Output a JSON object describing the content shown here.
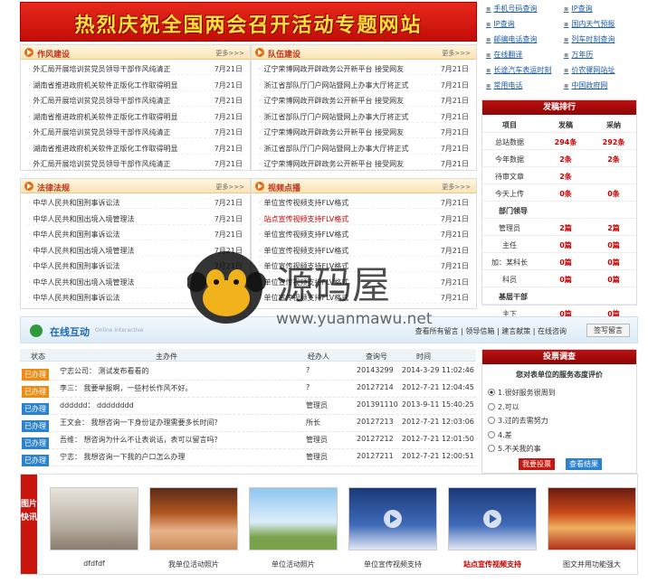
{
  "banner": {
    "title": "热烈庆祝全国两会召开活动专题网站"
  },
  "quick_links": [
    "手机号码查询",
    "IP查询",
    "邮编电话查询",
    "在线翻译",
    "长途汽车表运时刻",
    "常用电话",
    "IP查询",
    "国内天气预报",
    "列车时刻查询",
    "万年历",
    "价农骤网站址",
    "中国政府网"
  ],
  "panels": [
    {
      "title": "作风建设",
      "more": "更多>>>",
      "rows": [
        {
          "t": "外汇局开展培训贫党员领导干部作风纯清正",
          "d": "7月21日"
        },
        {
          "t": "湖南省推进政府机关软件正版化工作取得明显",
          "d": "7月21日"
        },
        {
          "t": "外汇局开展培训贫党员领导干部作风纯清正",
          "d": "7月21日"
        },
        {
          "t": "湖南省推进政府机关软件正版化工作取得明显",
          "d": "7月21日"
        },
        {
          "t": "外汇局开展培训贫党员领导干部作风纯清正",
          "d": "7月21日"
        },
        {
          "t": "湖南省推进政府机关软件正版化工作取得明显",
          "d": "7月21日"
        },
        {
          "t": "外汇局开展培训贫党员领导干部作风纯清正",
          "d": "7月21日"
        }
      ]
    },
    {
      "title": "队伍建设",
      "more": "更多>>>",
      "rows": [
        {
          "t": "辽宁荣博网政开辟政务公开新平台 接受网友",
          "d": "7月21日"
        },
        {
          "t": "浙江省部队厅门户网站暨网上办事大厅将正式",
          "d": "7月21日"
        },
        {
          "t": "辽宁荣博网政开辟政务公开新平台 接受网友",
          "d": "7月21日"
        },
        {
          "t": "浙江省部队厅门户网站暨网上办事大厅将正式",
          "d": "7月21日"
        },
        {
          "t": "辽宁荣博网政开辟政务公开新平台 接受网友",
          "d": "7月21日"
        },
        {
          "t": "浙江省部队厅门户网站暨网上办事大厅将正式",
          "d": "7月21日"
        },
        {
          "t": "辽宁荣博网政开辟政务公开新平台 接受网友",
          "d": "7月21日"
        }
      ]
    },
    {
      "title": "法律法规",
      "more": "更多>>>",
      "rows": [
        {
          "t": "中华人民共和国刑事诉讼法",
          "d": "7月21日"
        },
        {
          "t": "中华人民共和国出境入境管理法",
          "d": "7月21日"
        },
        {
          "t": "中华人民共和国刑事诉讼法",
          "d": "7月21日"
        },
        {
          "t": "中华人民共和国出境入境管理法",
          "d": "7月21日"
        },
        {
          "t": "中华人民共和国刑事诉讼法",
          "d": "7月21日"
        },
        {
          "t": "中华人民共和国出境入境管理法",
          "d": "7月21日"
        },
        {
          "t": "中华人民共和国刑事诉讼法",
          "d": "7月21日"
        }
      ]
    },
    {
      "title": "视频点播",
      "more": "更多>>>",
      "rows": [
        {
          "t": "单位宣传视频支持FLV格式",
          "d": "7月21日"
        },
        {
          "t": "站点宣传视频支持FLV格式",
          "d": "7月21日"
        },
        {
          "t": "单位宣传视频支持FLV格式",
          "d": "7月21日"
        },
        {
          "t": "单位宣传视频支持FLV格式",
          "d": "7月21日"
        },
        {
          "t": "单位宣传视频支持FLV格式",
          "d": "7月21日"
        },
        {
          "t": "单位宣传视频支持FLV格式",
          "d": "7月21日"
        },
        {
          "t": "单位宣传视频支持FLV格式",
          "d": "7月21日"
        }
      ]
    }
  ],
  "rank": {
    "title": "发稿排行",
    "head": [
      "项目",
      "发稿",
      "采纳"
    ],
    "rows": [
      [
        "总站数据",
        "294条",
        "292条"
      ],
      [
        "今年数据",
        "2条",
        "2条"
      ],
      [
        "待审文章",
        "2条",
        ""
      ],
      [
        "今天上传",
        "0条",
        "0条"
      ]
    ],
    "sec1": "部门领导",
    "rows2": [
      [
        "管理员",
        "2篇",
        "2篇"
      ],
      [
        "主任",
        "0篇",
        "0篇"
      ],
      [
        "加：某科长",
        "0篇",
        "0篇"
      ],
      [
        "科员",
        "0篇",
        "0篇"
      ]
    ],
    "sec2": "基层干部",
    "rows3": [
      [
        "主下",
        "0篇",
        "0篇"
      ]
    ]
  },
  "interact": {
    "title": "在线互动",
    "sub": "Online Interactive",
    "nav": "查看所有留言 | 领导信箱 | 建言献策 | 在线咨询",
    "button": "签写留言"
  },
  "table": {
    "head": [
      "状态",
      "主办件",
      "经办人",
      "查询号",
      "时间"
    ],
    "rows": [
      {
        "s": "已办理",
        "c": "o",
        "t": "宁志公司：  测试发布看看的",
        "p": "?",
        "n": "20143299",
        "d": "2014-3-29 11:02:46"
      },
      {
        "s": "已办理",
        "c": "o",
        "t": "李三：  我要举报啊，一些村长作风不好。",
        "p": "?",
        "n": "20127214",
        "d": "2012-7-21 12:04:45"
      },
      {
        "s": "已办理",
        "c": "b",
        "t": "dddddd：  dddddddd",
        "p": "管理员",
        "n": "201391110",
        "d": "2013-9-11 15:40:25"
      },
      {
        "s": "已办理",
        "c": "b",
        "t": "王文会：  我想咨询一下身份证办理需要多长时间？",
        "p": "所长",
        "n": "20127213",
        "d": "2012-7-21 12:03:06"
      },
      {
        "s": "已办理",
        "c": "b",
        "t": "吾维：  想咨询为什么不让表说话，表可以留言吗？",
        "p": "管理员",
        "n": "20127212",
        "d": "2012-7-21 12:01:50"
      },
      {
        "s": "已办理",
        "c": "b",
        "t": "宁志：  我想咨询一下我的户口怎么办理",
        "p": "管理员",
        "n": "20127211",
        "d": "2012-7-21 12:00:51"
      }
    ]
  },
  "survey": {
    "title": "投票调查",
    "question": "您对表单位的服务态度评价",
    "options": [
      "1.很好服务很周到",
      "2.可以",
      "3.过的去需努力",
      "4.差",
      "5.不关我的事"
    ],
    "vote": "我要投票",
    "result": "查看结果"
  },
  "photos": {
    "label": "图片快讯",
    "items": [
      {
        "cap": "dfdfdf"
      },
      {
        "cap": "我单位活动照片"
      },
      {
        "cap": "单位活动照片"
      },
      {
        "cap": "单位宣传视频支持"
      },
      {
        "cap": "站点宣传视频支持",
        "red": true
      },
      {
        "cap": "图文并用功能强大"
      }
    ]
  },
  "watermark": {
    "cn": "源码屋",
    "url": "www.yuanmawu.net"
  }
}
